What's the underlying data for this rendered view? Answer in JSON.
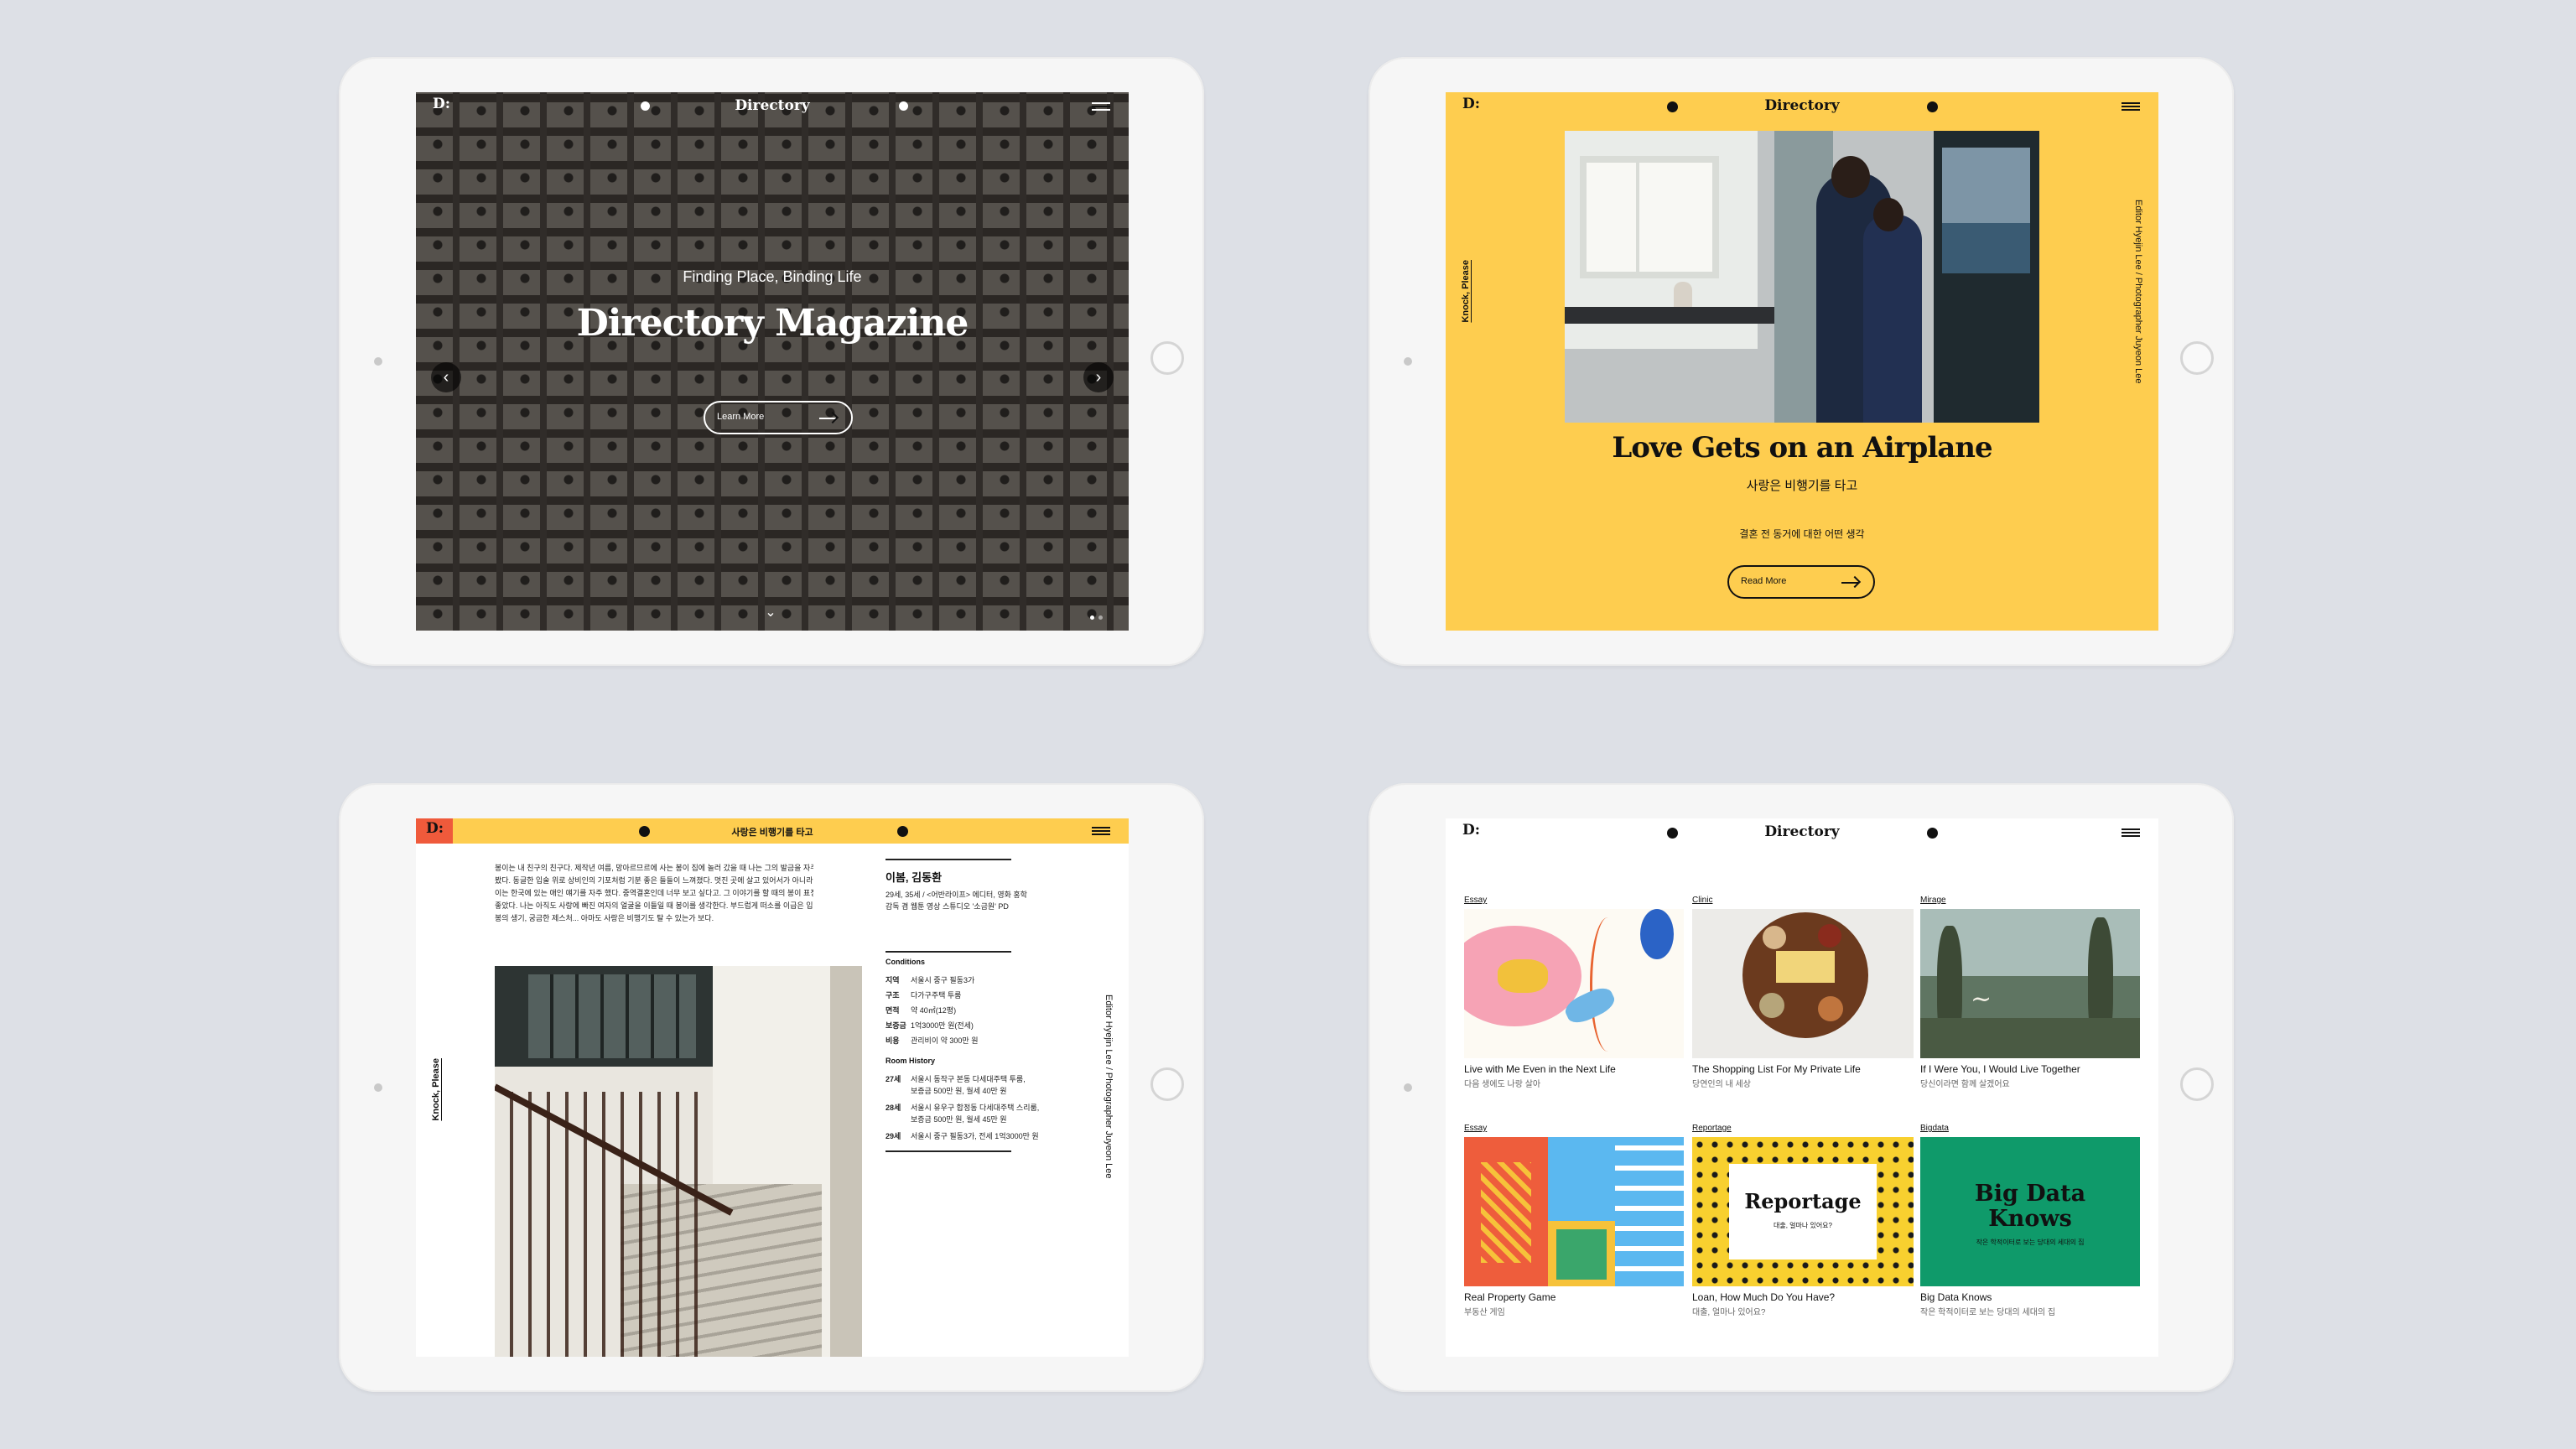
{
  "brand": {
    "logo": "D:",
    "name": "Directory"
  },
  "hero": {
    "subtitle": "Finding Place, Binding Life",
    "title": "Directory Magazine",
    "cta_label": "Learn More"
  },
  "feature": {
    "side_left": "Knock, Please",
    "side_right": "Editor Hyejin Lee / Photographer Juyeon Lee",
    "title": "Love Gets on an Airplane",
    "title_ko": "사랑은 비행기를 타고",
    "tagline_ko": "결혼 전 동거에 대한 어떤 생각",
    "cta_label": "Read More"
  },
  "article": {
    "header_title": "사랑은 비행기를 타고",
    "body_lines": [
      "봉이는 내 친구의 친구다. 제작년 여름, 망아르므르에 사는 봉이 집에 놀러 갔을 때 나는 그의 발금을 자주",
      "봤다. 동글한 입술 위로 상비인의 기포처럼 기분 좋은 들들이 느껴졌다. 멋진 곳에 살고 있어서가 아니라 봉",
      "이는 한국에 있는 애인 얘기를 자주 했다. 중역결혼인데 너무 보고 싶다고. 그 이야기를 할 때의 봉이 표정이",
      "좋았다. 나는 아직도 사랑에 빠진 여자의 얼굴을 이들일 때 봉이를 생각한다. 부드럽게 떠소를 이급은 입가,",
      "봉의 생기, 궁금한 제스처... 아마도 사랑은 비행기도 탈 수 있는가 보다."
    ],
    "interviewee": "이봄, 김동환",
    "bio_lines": [
      "29세, 35세 / <어반라이프> 에디터, 영화 홍학",
      "감독 겸 웹툰 영상 스튜디오 '소금원' PD"
    ],
    "conditions_heading": "Conditions",
    "conditions": [
      {
        "key": "지역",
        "value": "서울시 중구 필동3가"
      },
      {
        "key": "구조",
        "value": "다가구주택 투룸"
      },
      {
        "key": "면적",
        "value": "약 40㎡(12평)"
      },
      {
        "key": "보증금",
        "value": "1억3000만 원(전세)"
      },
      {
        "key": "비용",
        "value": "관리비이 약 300만 원"
      }
    ],
    "history_heading": "Room History",
    "history": [
      {
        "key": "27세",
        "value": "서울시 동작구 본동 다세대주택 투룸,",
        "value2": "보증금 500만 원, 월세 40만 원"
      },
      {
        "key": "28세",
        "value": "서울시 유우구 합정동 다세대주택 스리룸,",
        "value2": "보증금 500만 원, 월세 45만 원"
      },
      {
        "key": "29세",
        "value": "서울시 중구 필동3가, 전세 1억3000만 원",
        "value2": ""
      }
    ],
    "side_left": "Knock, Please",
    "side_right": "Editor Hyejin Lee / Photographer Juyeon Lee"
  },
  "grid": {
    "cards": [
      {
        "label": "Essay",
        "title": "Live with Me Even in the Next Life",
        "sub": "다음 생에도 나랑 살아"
      },
      {
        "label": "Clinic",
        "title": "The Shopping List For My Private Life",
        "sub": "당연인의 내 세상"
      },
      {
        "label": "Mirage",
        "title": "If I Were You, I Would Live Together",
        "sub": "당신이라면 함께 살겠어요"
      },
      {
        "label": "Essay",
        "title": "Real Property Game",
        "sub": "부동산 게임"
      },
      {
        "label": "Reportage",
        "title": "Loan, How Much Do You Have?",
        "sub": "대출, 얼마나 있어요?",
        "art_title": "Reportage",
        "art_sub": "대출, 얼마나 있어요?"
      },
      {
        "label": "Bigdata",
        "title": "Big Data Knows",
        "sub": "작은 학적이터로 보는 당대의 세대의 집",
        "art_title_1": "Big Data",
        "art_title_2": "Knows",
        "art_sub": "작은 학적이터로 보는 당대의 세대의 집"
      }
    ]
  },
  "colors": {
    "background": "#dde0e6",
    "yellow": "#fecd4f",
    "accent_red": "#ef5a3b",
    "green": "#0f9a6a"
  }
}
